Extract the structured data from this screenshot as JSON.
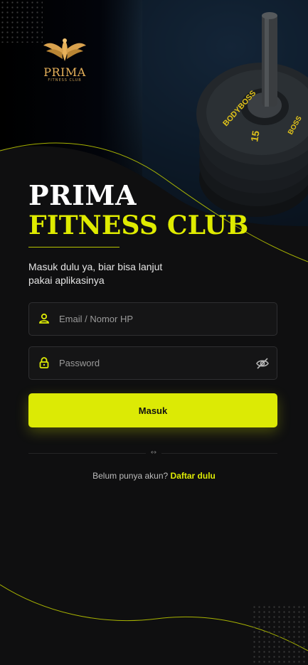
{
  "logo": {
    "text": "PRIMA",
    "subtitle": "FITNESS CLUB"
  },
  "brand": {
    "line1": "PRIMA",
    "line2": "FITNESS CLUB"
  },
  "tagline": "Masuk dulu ya, biar bisa lanjut pakai aplikasinya",
  "form": {
    "email_placeholder": "Email / Nomor HP",
    "password_placeholder": "Password",
    "submit_label": "Masuk"
  },
  "divider_symbol": "↔",
  "register": {
    "prompt": "Belum punya akun?",
    "link_label": "Daftar dulu"
  },
  "hero_plate_text": {
    "brand": "BODYBOSS",
    "weight": "15"
  },
  "colors": {
    "accent": "#dcea05",
    "background": "#0f0f10",
    "logo_gold": "#e7b15a"
  },
  "icons": {
    "user": "user-icon",
    "lock": "lock-icon",
    "eye_off": "eye-off-icon",
    "logo": "phoenix-logo-icon"
  }
}
